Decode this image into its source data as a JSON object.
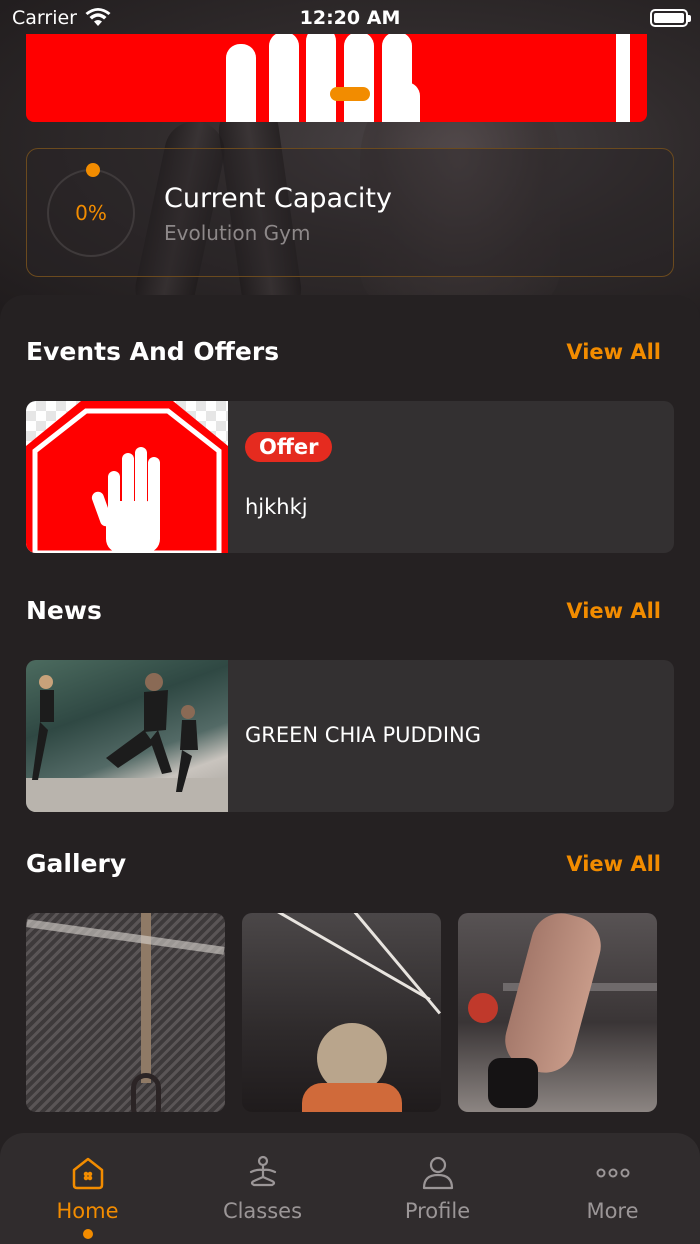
{
  "status_bar": {
    "carrier": "Carrier",
    "time": "12:20 AM"
  },
  "capacity": {
    "value": "0%",
    "title": "Current Capacity",
    "subtitle": "Evolution Gym"
  },
  "events": {
    "title": "Events And Offers",
    "view_all": "View All",
    "items": [
      {
        "badge": "Offer",
        "text": "hjkhkj"
      }
    ]
  },
  "news": {
    "title": "News",
    "view_all": "View All",
    "items": [
      {
        "text": "GREEN CHIA PUDDING"
      }
    ]
  },
  "gallery": {
    "title": "Gallery",
    "view_all": "View All"
  },
  "tabbar": {
    "items": [
      {
        "label": "Home",
        "icon": "home-icon",
        "active": true
      },
      {
        "label": "Classes",
        "icon": "meditation-icon",
        "active": false
      },
      {
        "label": "Profile",
        "icon": "person-icon",
        "active": false
      },
      {
        "label": "More",
        "icon": "more-dots-icon",
        "active": false
      }
    ]
  },
  "colors": {
    "accent": "#f28c00",
    "background": "#252122",
    "card": "#333031",
    "offer_badge": "#e52b1f",
    "banner": "#ff0000"
  }
}
